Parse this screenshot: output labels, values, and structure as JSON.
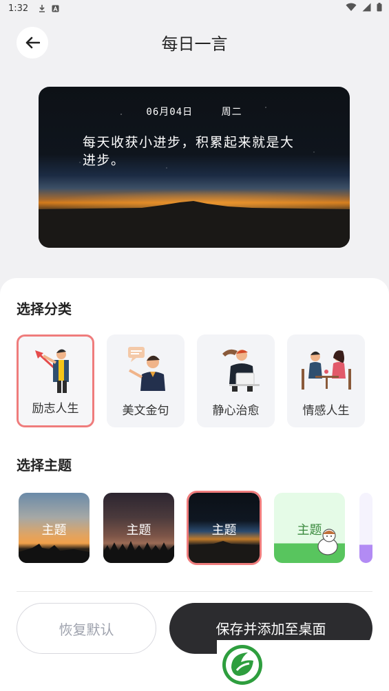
{
  "status_bar": {
    "time": "1:32"
  },
  "header": {
    "title": "每日一言"
  },
  "card": {
    "date": "06月04日",
    "weekday": "周二",
    "quote": "每天收获小进步，积累起来就是大进步。"
  },
  "categories": {
    "title": "选择分类",
    "items": [
      {
        "label": "励志人生",
        "selected": true
      },
      {
        "label": "美文金句",
        "selected": false
      },
      {
        "label": "静心治愈",
        "selected": false
      },
      {
        "label": "情感人生",
        "selected": false
      }
    ]
  },
  "themes": {
    "title": "选择主题",
    "items": [
      {
        "label": "主题",
        "selected": false
      },
      {
        "label": "主题",
        "selected": false
      },
      {
        "label": "主题",
        "selected": true
      },
      {
        "label": "主题",
        "selected": false
      }
    ]
  },
  "actions": {
    "reset_label": "恢复默认",
    "save_label": "保存并添加至桌面"
  },
  "colors": {
    "accent_border": "#ef7c7c",
    "primary_button": "#2c2c2f",
    "logo_green": "#2e9e3e"
  }
}
